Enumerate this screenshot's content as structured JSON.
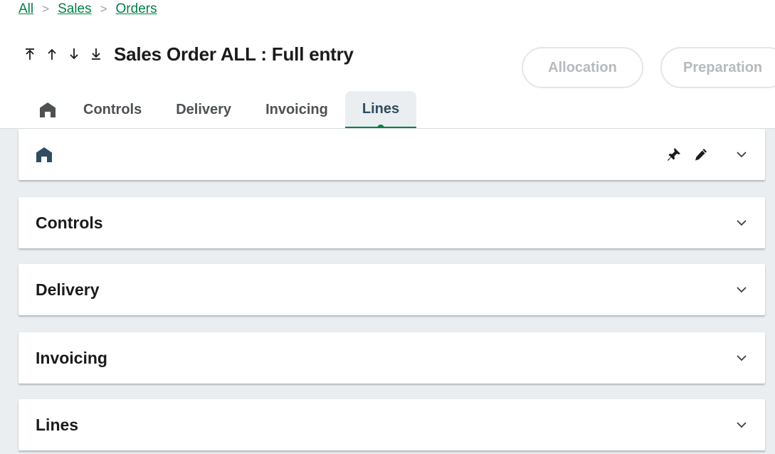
{
  "breadcrumb": {
    "items": [
      "All",
      "Sales",
      "Orders"
    ],
    "separator": ">"
  },
  "navigation": {
    "first_icon": "arrow-first-icon",
    "previous_icon": "arrow-up-icon",
    "next_icon": "arrow-down-icon",
    "last_icon": "arrow-last-icon"
  },
  "page": {
    "title": "Sales Order ALL : Full entry"
  },
  "actions": {
    "allocation_label": "Allocation",
    "preparation_label": "Preparation"
  },
  "tabs": [
    {
      "label": "",
      "icon": "home-icon"
    },
    {
      "label": "Controls"
    },
    {
      "label": "Delivery"
    },
    {
      "label": "Invoicing"
    },
    {
      "label": "Lines",
      "active": true
    }
  ],
  "sections": {
    "header": {
      "icon": "home-icon",
      "tools": [
        "pin-icon",
        "pencil-icon",
        "chevron-down-icon"
      ]
    },
    "controls": {
      "label": "Controls"
    },
    "delivery": {
      "label": "Delivery"
    },
    "invoicing": {
      "label": "Invoicing"
    },
    "lines": {
      "label": "Lines"
    }
  },
  "colors": {
    "accent": "#008146",
    "header_blue": "#2e4d60",
    "background": "#eaeef0",
    "disabled_text": "#b6babd"
  }
}
